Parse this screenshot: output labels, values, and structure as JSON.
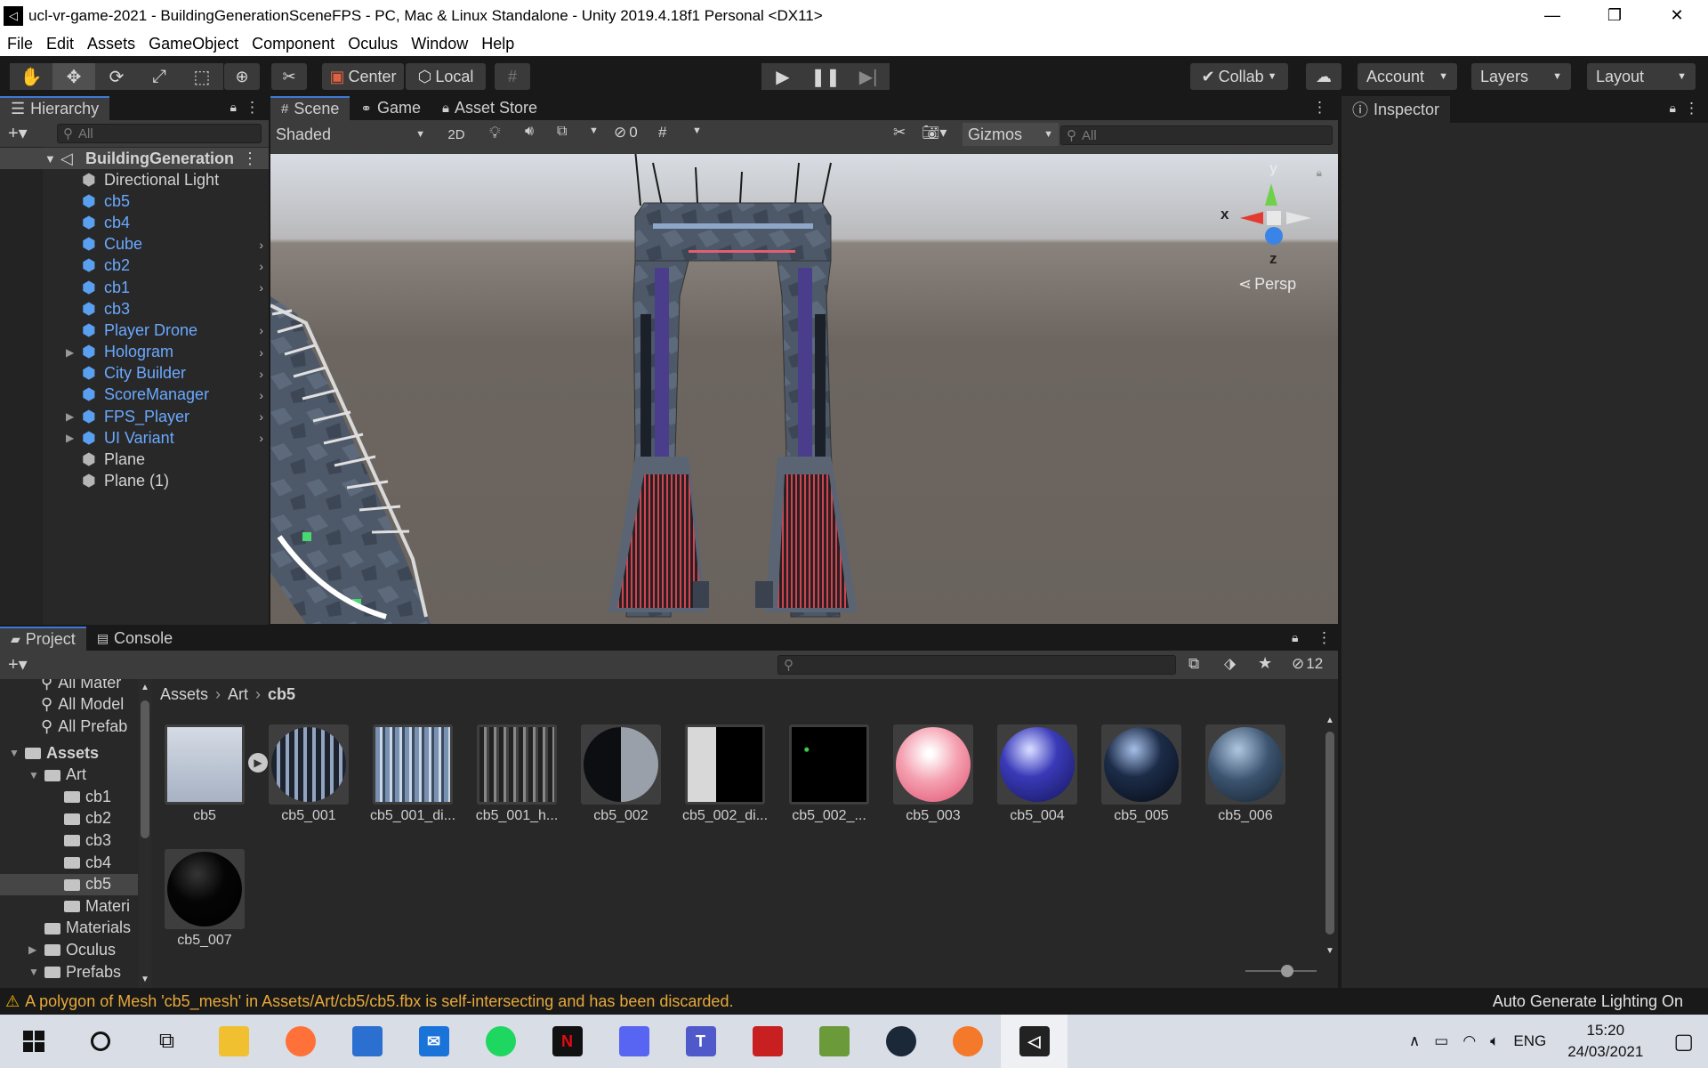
{
  "window": {
    "title": "ucl-vr-game-2021 - BuildingGenerationSceneFPS - PC, Mac & Linux Standalone - Unity 2019.4.18f1 Personal <DX11>",
    "min": "—",
    "restore": "❐",
    "close": "✕"
  },
  "menu": [
    "File",
    "Edit",
    "Assets",
    "GameObject",
    "Component",
    "Oculus",
    "Window",
    "Help"
  ],
  "toolbar": {
    "center": "Center",
    "local": "Local",
    "collab": "Collab",
    "account": "Account",
    "layers": "Layers",
    "layout": "Layout"
  },
  "hierarchy": {
    "tab": "Hierarchy",
    "search_placeholder": "All",
    "scene_name": "BuildingGeneration",
    "items": [
      {
        "label": "Directional Light",
        "blue": false,
        "expand": false,
        "arrow": false
      },
      {
        "label": "cb5",
        "blue": true,
        "expand": false,
        "arrow": false
      },
      {
        "label": "cb4",
        "blue": true,
        "expand": false,
        "arrow": false
      },
      {
        "label": "Cube",
        "blue": true,
        "expand": false,
        "arrow": true
      },
      {
        "label": "cb2",
        "blue": true,
        "expand": false,
        "arrow": true
      },
      {
        "label": "cb1",
        "blue": true,
        "expand": false,
        "arrow": true
      },
      {
        "label": "cb3",
        "blue": true,
        "expand": false,
        "arrow": false
      },
      {
        "label": "Player Drone",
        "blue": true,
        "expand": false,
        "arrow": true
      },
      {
        "label": "Hologram",
        "blue": true,
        "expand": true,
        "arrow": true
      },
      {
        "label": "City Builder",
        "blue": true,
        "expand": false,
        "arrow": true
      },
      {
        "label": "ScoreManager",
        "blue": true,
        "expand": false,
        "arrow": true
      },
      {
        "label": "FPS_Player",
        "blue": true,
        "expand": true,
        "arrow": true
      },
      {
        "label": "UI Variant",
        "blue": true,
        "expand": true,
        "arrow": true
      },
      {
        "label": "Plane",
        "blue": false,
        "expand": false,
        "arrow": false
      },
      {
        "label": "Plane (1)",
        "blue": false,
        "expand": false,
        "arrow": false
      }
    ]
  },
  "scene": {
    "tabs": [
      "Scene",
      "Game",
      "Asset Store"
    ],
    "shading": "Shaded",
    "mode2d": "2D",
    "hidden_count": "0",
    "gizmos": "Gizmos",
    "search_placeholder": "All",
    "persp": "Persp",
    "axis_x": "x",
    "axis_y": "y",
    "axis_z": "z"
  },
  "inspector": {
    "tab": "Inspector"
  },
  "project": {
    "tabs": [
      "Project",
      "Console"
    ],
    "hidden_count": "12",
    "breadcrumb": [
      "Assets",
      "Art",
      "cb5"
    ],
    "favorites": [
      "All Mater",
      "All Model",
      "All Prefab"
    ],
    "tree": [
      {
        "label": "Assets",
        "bold": true,
        "indent": 0,
        "expand": "down"
      },
      {
        "label": "Art",
        "bold": false,
        "indent": 1,
        "expand": "down"
      },
      {
        "label": "cb1",
        "bold": false,
        "indent": 2,
        "expand": ""
      },
      {
        "label": "cb2",
        "bold": false,
        "indent": 2,
        "expand": ""
      },
      {
        "label": "cb3",
        "bold": false,
        "indent": 2,
        "expand": ""
      },
      {
        "label": "cb4",
        "bold": false,
        "indent": 2,
        "expand": ""
      },
      {
        "label": "cb5",
        "bold": false,
        "indent": 2,
        "expand": "",
        "selected": true
      },
      {
        "label": "Materi",
        "bold": false,
        "indent": 2,
        "expand": ""
      },
      {
        "label": "Materials",
        "bold": false,
        "indent": 1,
        "expand": ""
      },
      {
        "label": "Oculus",
        "bold": false,
        "indent": 1,
        "expand": "right"
      },
      {
        "label": "Prefabs",
        "bold": false,
        "indent": 1,
        "expand": "down"
      }
    ],
    "assets": [
      {
        "label": "cb5",
        "kind": "model"
      },
      {
        "label": "cb5_001",
        "kind": "sphere-stripes"
      },
      {
        "label": "cb5_001_di...",
        "kind": "tex-blue"
      },
      {
        "label": "cb5_001_h...",
        "kind": "tex-gray"
      },
      {
        "label": "cb5_002",
        "kind": "sphere-half"
      },
      {
        "label": "cb5_002_di...",
        "kind": "tex-bw"
      },
      {
        "label": "cb5_002_...",
        "kind": "tex-green"
      },
      {
        "label": "cb5_003",
        "kind": "sphere-pink"
      },
      {
        "label": "cb5_004",
        "kind": "sphere-blue"
      },
      {
        "label": "cb5_005",
        "kind": "sphere-navy"
      },
      {
        "label": "cb5_006",
        "kind": "sphere-steel"
      },
      {
        "label": "cb5_007",
        "kind": "sphere-black"
      }
    ]
  },
  "status": {
    "warning": "A polygon of Mesh 'cb5_mesh' in Assets/Art/cb5/cb5.fbx is self-intersecting and has been discarded.",
    "right": "Auto Generate Lighting On"
  },
  "taskbar": {
    "lang": "ENG",
    "time": "15:20",
    "date": "24/03/2021"
  },
  "colors": {
    "accent": "#3b7bd6",
    "warning": "#e8a93a",
    "prefab_blue": "#6aa9ff"
  }
}
